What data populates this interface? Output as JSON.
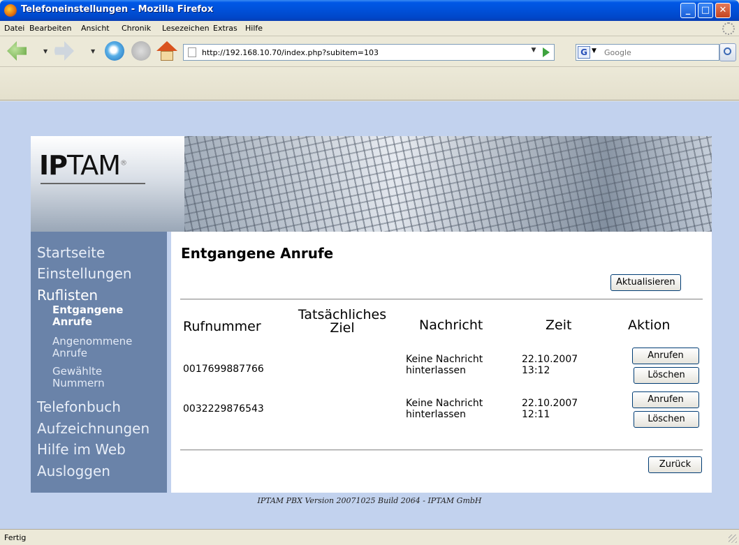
{
  "window": {
    "title": "Telefoneinstellungen - Mozilla Firefox",
    "minimize": "_",
    "maximize": "□",
    "close": "✕"
  },
  "menu": [
    "Datei",
    "Bearbeiten",
    "Ansicht",
    "Chronik",
    "Lesezeichen",
    "Extras",
    "Hilfe"
  ],
  "navbar": {
    "url": "http://192.168.10.70/index.php?subitem=103",
    "search_placeholder": "Google",
    "search_engine_letter": "G"
  },
  "banner": {
    "logo_bold": "IP",
    "logo_rest": "TAM",
    "logo_mark": "®"
  },
  "sidebar": {
    "items": [
      "Startseite",
      "Einstellungen",
      "Ruflisten",
      "Telefonbuch",
      "Aufzeichnungen",
      "Hilfe im Web",
      "Ausloggen"
    ],
    "subitems": [
      "Entgangene Anrufe",
      "Angenommene Anrufe",
      "Gewählte Nummern"
    ]
  },
  "content": {
    "heading": "Entgangene Anrufe",
    "refresh_button": "Aktualisieren",
    "back_button": "Zurück",
    "columns": [
      "Rufnummer",
      "Tatsächliches Ziel",
      "Nachricht",
      "Zeit",
      "Aktion"
    ],
    "rows": [
      {
        "number": "0017699887766",
        "target": "",
        "message": "Keine Nachricht hinterlassen",
        "time": "22.10.2007 13:12",
        "call_label": "Anrufen",
        "delete_label": "Löschen"
      },
      {
        "number": "0032229876543",
        "target": "",
        "message": "Keine Nachricht hinterlassen",
        "time": "22.10.2007 12:11",
        "call_label": "Anrufen",
        "delete_label": "Löschen"
      }
    ]
  },
  "footer": "IPTAM PBX Version 20071025 Build 2064 - IPTAM GmbH",
  "status": "Fertig"
}
